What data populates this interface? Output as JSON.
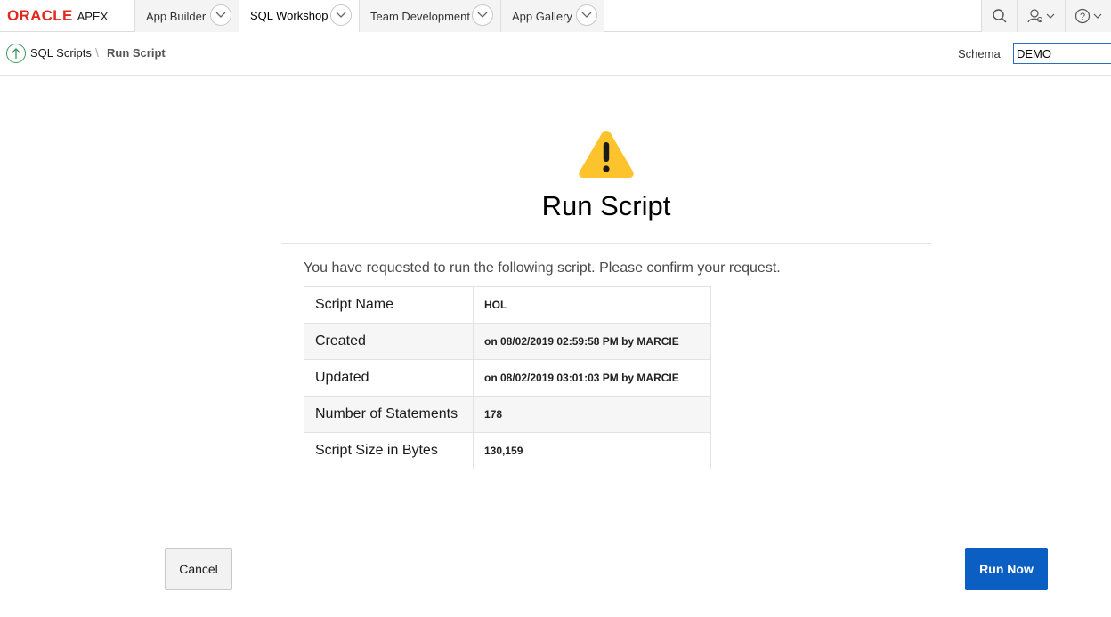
{
  "brand": {
    "oracle": "ORACLE",
    "apex": "APEX",
    "accent_color": "#e0281c"
  },
  "nav": {
    "tabs": [
      {
        "label": "App Builder"
      },
      {
        "label": "SQL Workshop"
      },
      {
        "label": "Team Development"
      },
      {
        "label": "App Gallery"
      }
    ],
    "icons": [
      "search-icon",
      "user-icon",
      "help-icon"
    ]
  },
  "breadcrumb": {
    "parent": "SQL Scripts",
    "separator": "\\",
    "current": "Run Script"
  },
  "schema": {
    "label": "Schema",
    "value": "DEMO"
  },
  "page": {
    "title": "Run Script",
    "message": "You have requested to run the following script. Please confirm your request."
  },
  "details": [
    {
      "label": "Script Name",
      "value": "HOL"
    },
    {
      "label": "Created",
      "value": "on 08/02/2019 02:59:58 PM by MARCIE"
    },
    {
      "label": "Updated",
      "value": "on 08/02/2019 03:01:03 PM by MARCIE"
    },
    {
      "label": "Number of Statements",
      "value": "178"
    },
    {
      "label": "Script Size in Bytes",
      "value": "130,159"
    }
  ],
  "buttons": {
    "cancel": "Cancel",
    "run_now": "Run Now",
    "primary_color": "#0b5fc2"
  }
}
